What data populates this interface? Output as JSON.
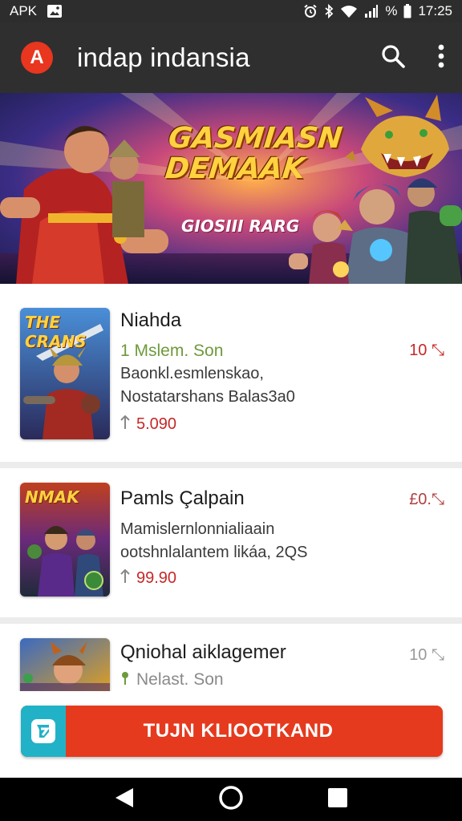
{
  "status_bar": {
    "left_text": "APK",
    "time": "17:25",
    "battery_text": "%",
    "icons": [
      "image-icon",
      "alarm-icon",
      "bluetooth-icon",
      "wifi-icon",
      "signal-icon"
    ]
  },
  "app_bar": {
    "logo_letter": "A",
    "title": "indap indansia",
    "actions": [
      "search-icon",
      "more-vert-icon"
    ]
  },
  "banner": {
    "title_line1": "GASMIASN",
    "title_line2": "DEMAAK",
    "subtitle": "GIOSIII RARG",
    "colors": {
      "sky": "#2b2a6e",
      "burst": "#ff8a2a",
      "title": "#ffd23f"
    }
  },
  "games": [
    {
      "thumb_text": "THE CRANS",
      "name": "Niahda",
      "meta": "1 Mslem. Son",
      "desc_line1": "Baonkl.esmlenskao,",
      "desc_line2": "Nostatarshans Balas3a0",
      "price": "5.090",
      "size": "10 ⤡"
    },
    {
      "thumb_text": "NMAK",
      "name": "Pamls Çalpain",
      "meta": "",
      "desc_line1": "Mamislernlonnialiaain",
      "desc_line2": "ootshnlalantem likáa, 2QS",
      "price": "99.90",
      "size": "£0.⤡"
    },
    {
      "thumb_text": "",
      "name": "Qniohal aiklagemer",
      "meta": "Nelast. Son",
      "desc_line1": "",
      "desc_line2": "",
      "price": "",
      "size": "10 ⤡"
    }
  ],
  "cta": {
    "label": "TUJN KLIOOTKAND",
    "icon": "app-store-icon"
  },
  "nav_bar": [
    "back-icon",
    "home-icon",
    "recents-icon"
  ]
}
